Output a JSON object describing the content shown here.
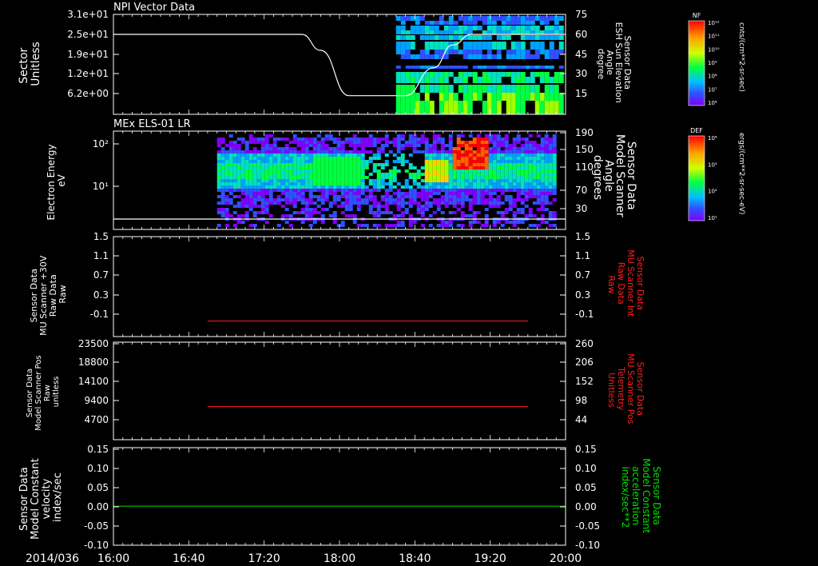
{
  "chart_data": [
    {
      "type": "heatmap",
      "title": "NPI Vector Data",
      "ylabel_left": [
        "Sector",
        "Unitless"
      ],
      "yticks_left": [
        "3.1e+01",
        "2.5e+01",
        "1.9e+01",
        "1.2e+01",
        "6.2e+00"
      ],
      "ylabel_right": [
        "Sensor Data",
        "ESH Sun Elevation",
        "Angle",
        "degree"
      ],
      "yticks_right": [
        "75",
        "60",
        "45",
        "30",
        "15"
      ],
      "xlim": [
        0,
        240
      ],
      "ylim_right": [
        0,
        75
      ],
      "line_series": {
        "x": [
          0,
          20,
          40,
          60,
          80,
          90,
          100,
          110,
          125,
          140,
          155,
          170,
          180,
          190,
          200,
          220,
          240
        ],
        "y": [
          60,
          60,
          60,
          60,
          60,
          60,
          60,
          48,
          14,
          14,
          14,
          35,
          52,
          60,
          60,
          60,
          60
        ]
      },
      "heatmap_start_x": 150,
      "colorbar": {
        "label": "NF",
        "unit": "cnts/(cm**2-sr-sec)",
        "ticks": [
          "10¹²",
          "10¹¹",
          "10¹⁰",
          "10⁹",
          "10⁸",
          "10⁷",
          "10⁶"
        ]
      }
    },
    {
      "type": "heatmap",
      "title": "MEx ELS-01 LR",
      "ylabel_left": [
        "Electron Energy",
        "eV"
      ],
      "yticks_left": [
        "10²",
        "10¹"
      ],
      "ylabel_right": [
        "Sensor Data",
        "Model Scanner",
        "Angle",
        "degrees"
      ],
      "yticks_right": [
        "190",
        "150",
        "110",
        "70",
        "30"
      ],
      "xlim": [
        0,
        240
      ],
      "heatmap_start_x": 55,
      "colorbar": {
        "label": "DEF",
        "unit": "ergs/(cm**2-sr-sec-eV)",
        "ticks": [
          "10⁴",
          "10³",
          "10²",
          "10¹"
        ]
      }
    },
    {
      "type": "line",
      "ylabel_left": [
        "Sensor Data",
        "MU Scanner +30V",
        "Raw Data",
        "Raw"
      ],
      "yticks_left": [
        "1.5",
        "1.1",
        "0.7",
        "0.3",
        "-0.1"
      ],
      "ylabel_right": [
        "Sensor Data",
        "MU Scanner Int",
        "Raw Data",
        "Raw"
      ],
      "yticks_right": [
        "1.5",
        "1.1",
        "0.7",
        "0.3",
        "-0.1"
      ],
      "xlim": [
        0,
        240
      ],
      "ylim": [
        -0.3,
        1.5
      ],
      "series": [
        {
          "x": [
            50,
            220
          ],
          "y": [
            -0.02,
            -0.02
          ],
          "color": "#e31a1c"
        }
      ]
    },
    {
      "type": "line",
      "ylabel_left": [
        "Sensor Data",
        "Model Scanner Pos",
        "Raw",
        "unitless"
      ],
      "yticks_left": [
        "23500",
        "18800",
        "14100",
        "9400",
        "4700"
      ],
      "ylabel_right": [
        "Sensor Data",
        "MU Scanner Pos",
        "Telemetry",
        "Unitless"
      ],
      "yticks_right": [
        "260",
        "206",
        "152",
        "98",
        "44"
      ],
      "xlim": [
        0,
        240
      ],
      "ylim": [
        0,
        23500
      ],
      "series": [
        {
          "x": [
            50,
            220
          ],
          "y": [
            8000,
            8000
          ],
          "color": "#e31a1c"
        }
      ]
    },
    {
      "type": "line",
      "ylabel_left": [
        "Sensor Data",
        "Model Constant",
        "velocity",
        "index/sec"
      ],
      "yticks_left": [
        "0.15",
        "0.10",
        "0.05",
        "0.00",
        "-0.05",
        "-0.10"
      ],
      "ylabel_right": [
        "Sensor Data",
        "Model Constant",
        "acceleration",
        "index/sec**2"
      ],
      "yticks_right": [
        "0.15",
        "0.10",
        "0.05",
        "0.00",
        "-0.05",
        "-0.10"
      ],
      "xlim": [
        0,
        240
      ],
      "ylim": [
        -0.1,
        0.15
      ],
      "series": [
        {
          "x": [
            0,
            240
          ],
          "y": [
            0.0,
            0.0
          ],
          "color": "#00c000"
        }
      ]
    }
  ],
  "x_axis": {
    "date": "2014/036",
    "ticks": [
      "16:00",
      "16:40",
      "17:20",
      "18:00",
      "18:40",
      "19:20",
      "20:00"
    ]
  },
  "colors": {
    "axes": "#ffffff",
    "red_label": "#ff2020",
    "green_label": "#00e000",
    "background": "#000000"
  }
}
